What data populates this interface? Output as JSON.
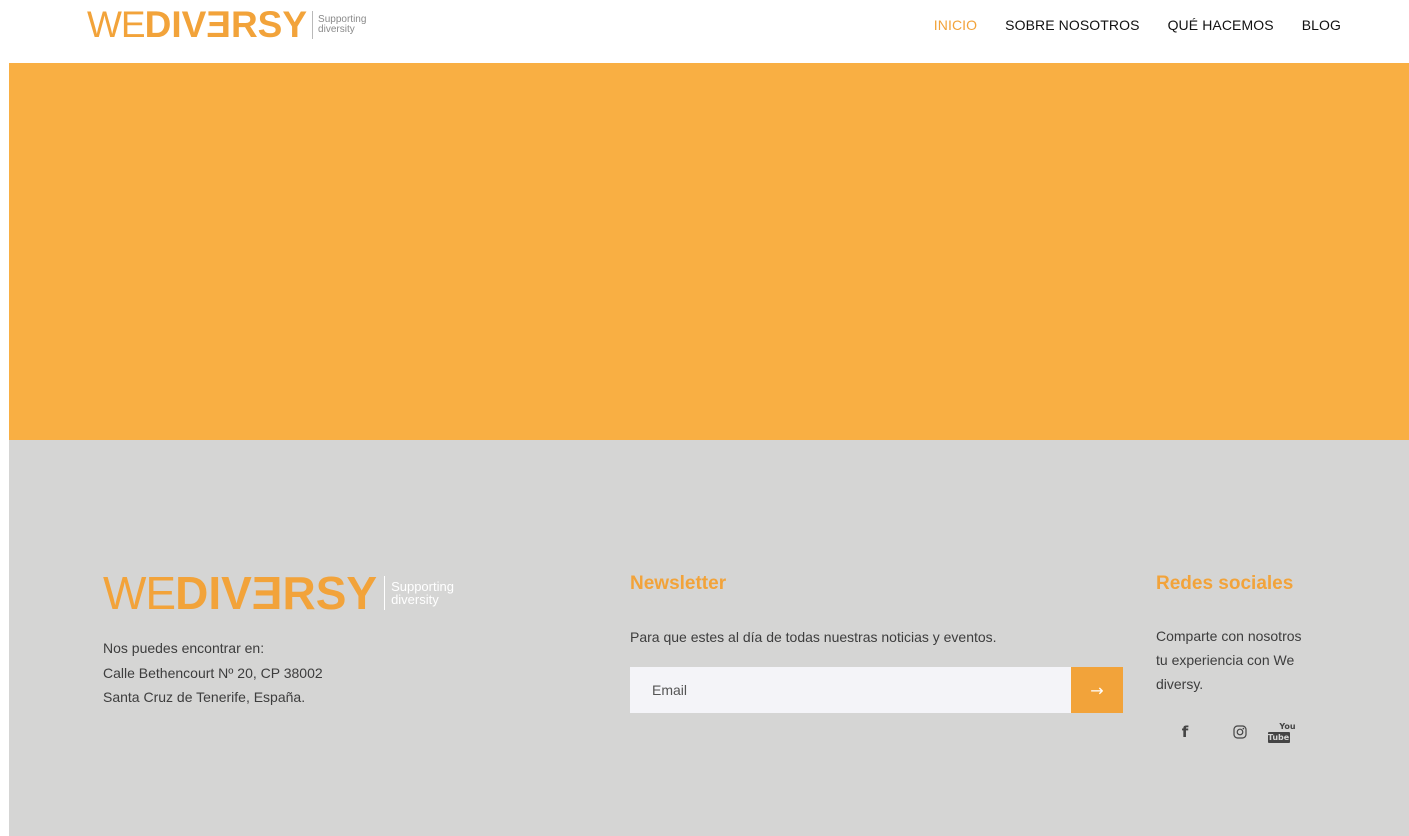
{
  "brand": {
    "logo_we": "WE",
    "logo_diversy": "DIVƎRSY",
    "tagline_line1": "Supporting",
    "tagline_line2": "diversity",
    "accent_color": "#f2a33a",
    "hero_color": "#f9af43",
    "footer_bg": "#d5d5d4"
  },
  "nav": {
    "items": [
      {
        "label": "INICIO",
        "active": true
      },
      {
        "label": "SOBRE NOSOTROS",
        "active": false
      },
      {
        "label": "QUÉ HACEMOS",
        "active": false
      },
      {
        "label": "BLOG",
        "active": false
      }
    ]
  },
  "footer": {
    "address": {
      "line1": "Nos puedes encontrar en:",
      "line2": "Calle Bethencourt Nº 20, CP 38002",
      "line3": "Santa Cruz de Tenerife, España."
    },
    "newsletter": {
      "title": "Newsletter",
      "text": "Para que estes al día de todas nuestras noticias y eventos.",
      "placeholder": "Email",
      "submit_icon": "→"
    },
    "social": {
      "title": "Redes sociales",
      "text_line1": "Comparte con nosotros",
      "text_line2": "tu experiencia con We",
      "text_line3": "diversy.",
      "icons": [
        "facebook-icon",
        "instagram-icon",
        "youtube-icon"
      ],
      "facebook_glyph": "f",
      "youtube_you": "You",
      "youtube_tube": "Tube"
    }
  }
}
